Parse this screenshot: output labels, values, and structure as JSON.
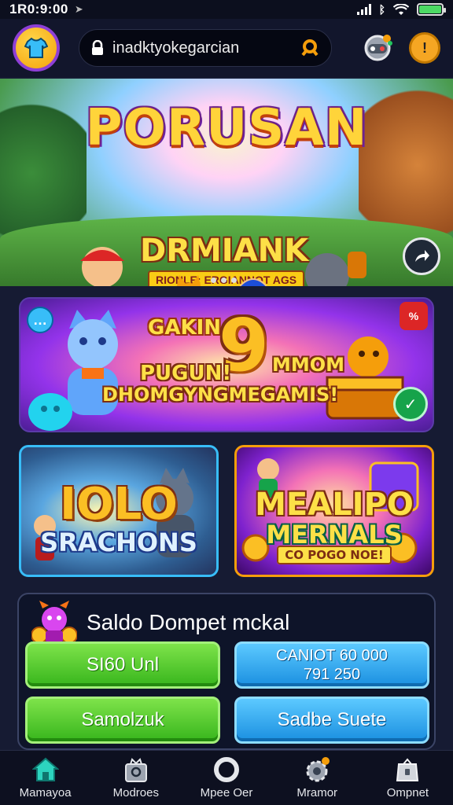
{
  "status_bar": {
    "time": "1R0:9:00",
    "battery_level": 1.0
  },
  "top_bar": {
    "url": "inadktyokegarcian"
  },
  "hero_banner": {
    "title": "PORUSAN",
    "subtitle": "DRMIANK",
    "tagline": "RIONLE: ERGIANNOT AGS",
    "slide_count": 3
  },
  "promo_banner": {
    "label_top": "GAKIN",
    "big_number": "9",
    "line_left": "PUGUN!",
    "line_right": "MMOM",
    "line_bottom": "DHOMGYNGMEGAMIS!",
    "corner_badge": "%"
  },
  "game_tiles": [
    {
      "line1": "IOLO",
      "line2": "SRACHONS"
    },
    {
      "line1": "MEALIPO",
      "line2": "MERNALS",
      "line3": "CO POGO NOE!"
    }
  ],
  "wallet": {
    "title": "Saldo Dompet mckal",
    "buttons": [
      {
        "label": "SI60 Unl"
      },
      {
        "label": "CANIOT 60 000",
        "amount": "791 250"
      },
      {
        "label": "Samolzuk"
      },
      {
        "label": "Sadbe Suete"
      }
    ]
  },
  "bottom_nav": [
    {
      "label": "Mamayoa",
      "icon": "home-icon",
      "active": true
    },
    {
      "label": "Modroes",
      "icon": "gift-box-icon"
    },
    {
      "label": "Mpee Oer",
      "icon": "ring-icon"
    },
    {
      "label": "Mramor",
      "icon": "gear-badge-icon"
    },
    {
      "label": "Ompnet",
      "icon": "wallet-bag-icon"
    }
  ],
  "colors": {
    "accent_green": "#37b51c",
    "accent_blue": "#1a8fe0",
    "background": "#161b33"
  }
}
